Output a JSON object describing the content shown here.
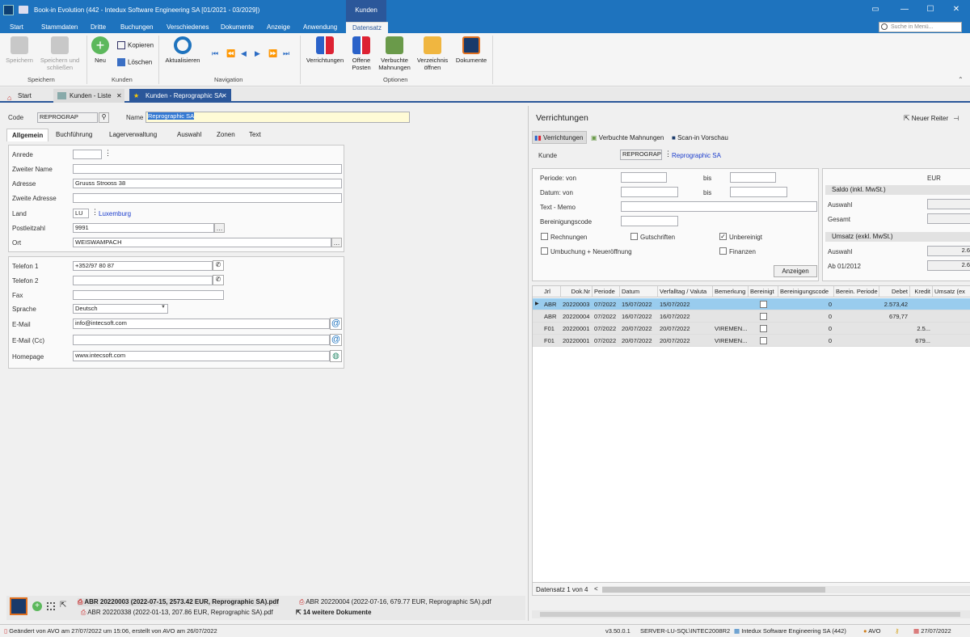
{
  "window": {
    "title": "Book-in Evolution (442 - Intedux Software Engineering SA [01/2021 - 03/2029])",
    "context_tab": "Kunden"
  },
  "ribbon_tabs": [
    "Start",
    "Stammdaten",
    "Dritte",
    "Buchungen",
    "Verschiedenes",
    "Dokumente",
    "Anzeige",
    "Anwendung",
    "Datensatz"
  ],
  "search": {
    "placeholder": "Suche in Menü..."
  },
  "ribbon": {
    "save": "Speichern",
    "save_close": "Speichern und schließen",
    "group_save": "Speichern",
    "new": "Neu",
    "copy": "Kopieren",
    "delete": "Löschen",
    "group_customers": "Kunden",
    "refresh": "Aktualisieren",
    "group_navigation": "Navigation",
    "transactions": "Verrichtungen",
    "open_items": "Offene Posten",
    "booked_reminders": "Verbuchte Mahnungen",
    "open_folder": "Verzeichnis öffnen",
    "documents": "Dokumente",
    "group_options": "Optionen"
  },
  "doc_tabs": [
    "Start",
    "Kunden - Liste",
    "Kunden - Reprographic SA"
  ],
  "form": {
    "code_label": "Code",
    "code_value": "REPROGRAP",
    "name_label": "Name",
    "name_value": "Reprographic SA",
    "tabs": [
      "Allgemein",
      "Buchführung",
      "Lagerverwaltung",
      "Auswahl",
      "Zonen",
      "Text"
    ],
    "anrede_label": "Anrede",
    "zweiter_name_label": "Zweiter Name",
    "adresse_label": "Adresse",
    "adresse_value": "Gruuss Strooss 38",
    "zweite_adresse_label": "Zweite Adresse",
    "land_label": "Land",
    "land_code": "LU",
    "land_name": "Luxemburg",
    "plz_label": "Postleitzahl",
    "plz_value": "9991",
    "ort_label": "Ort",
    "ort_value": "WEISWAMPACH",
    "tel1_label": "Telefon 1",
    "tel1_value": "+352/97 80 87",
    "tel2_label": "Telefon 2",
    "fax_label": "Fax",
    "sprache_label": "Sprache",
    "sprache_value": "Deutsch",
    "email_label": "E-Mail",
    "email_value": "info@intecsoft.com",
    "emailcc_label": "E-Mail (Cc)",
    "homepage_label": "Homepage",
    "homepage_value": "www.intecsoft.com"
  },
  "attachments": {
    "file1": "ABR 20220003 (2022-07-15, 2573.42 EUR, Reprographic SA).pdf",
    "file2": "ABR 20220004 (2022-07-16, 679.77 EUR, Reprographic SA).pdf",
    "file3": "ABR 20220338 (2022-01-13, 207.86 EUR, Reprographic SA).pdf",
    "more": "14 weitere Dokumente"
  },
  "right": {
    "title": "Verrichtungen",
    "new_tab": "Neuer Reiter",
    "tabs": [
      "Verrichtungen",
      "Verbuchte Mahnungen",
      "Scan-in Vorschau"
    ],
    "kunde_label": "Kunde",
    "kunde_code": "REPROGRAP",
    "kunde_name": "Reprographic SA",
    "periode_label": "Periode: von",
    "bis": "bis",
    "datum_label": "Datum: von",
    "text_label": "Text - Memo",
    "bereinigung_label": "Bereinigungscode",
    "cb_rechnungen": "Rechnungen",
    "cb_gutschriften": "Gutschriften",
    "cb_unbereinigt": "Unbereinigt",
    "cb_umbuchung": "Umbuchung + Neueröffnung",
    "cb_finanzen": "Finanzen",
    "show_btn": "Anzeigen",
    "currency": "EUR",
    "saldo_hdr": "Saldo (inkl. MwSt.)",
    "auswahl": "Auswahl",
    "gesamt": "Gesamt",
    "umsatz_hdr": "Umsatz (exkl. MwSt.)",
    "ab": "Ab 01/2012",
    "umsatz_auswahl": "2.6",
    "umsatz_ab": "2.6",
    "columns": [
      "Jrl",
      "Dok.Nr",
      "Periode",
      "Datum",
      "Verfalltag / Valuta",
      "Bemerkung",
      "Bereinigt",
      "Bereinigungscode",
      "Berein. Periode",
      "Debet",
      "Kredit",
      "Umsatz (ex"
    ],
    "rows": [
      {
        "jrl": "ABR",
        "nr": "20220003",
        "per": "07/2022",
        "dat": "15/07/2022",
        "val": "15/07/2022",
        "bem": "",
        "code": "0",
        "debet": "2.573,42",
        "kredit": ""
      },
      {
        "jrl": "ABR",
        "nr": "20220004",
        "per": "07/2022",
        "dat": "16/07/2022",
        "val": "16/07/2022",
        "bem": "",
        "code": "0",
        "debet": "679,77",
        "kredit": ""
      },
      {
        "jrl": "F01",
        "nr": "20220001",
        "per": "07/2022",
        "dat": "20/07/2022",
        "val": "20/07/2022",
        "bem": "VIREMEN...",
        "code": "0",
        "debet": "",
        "kredit": "2.5..."
      },
      {
        "jrl": "F01",
        "nr": "20220001",
        "per": "07/2022",
        "dat": "20/07/2022",
        "val": "20/07/2022",
        "bem": "VIREMEN...",
        "code": "0",
        "debet": "",
        "kredit": "679..."
      }
    ],
    "record_nav": "Datensatz 1 von 4"
  },
  "status": {
    "changed": "Geändert von AVO am 27/07/2022 um 15:06, erstellt von AVO am 26/07/2022",
    "version": "v3.50.0.1",
    "server": "SERVER-LU-SQL\\INTEC2008R2",
    "company": "Intedux Software Engineering SA (442)",
    "user": "AVO",
    "date": "27/07/2022"
  },
  "colors": {
    "brand": "#1e73be",
    "selection": "#99ccee",
    "link": "#1a3ccc"
  }
}
